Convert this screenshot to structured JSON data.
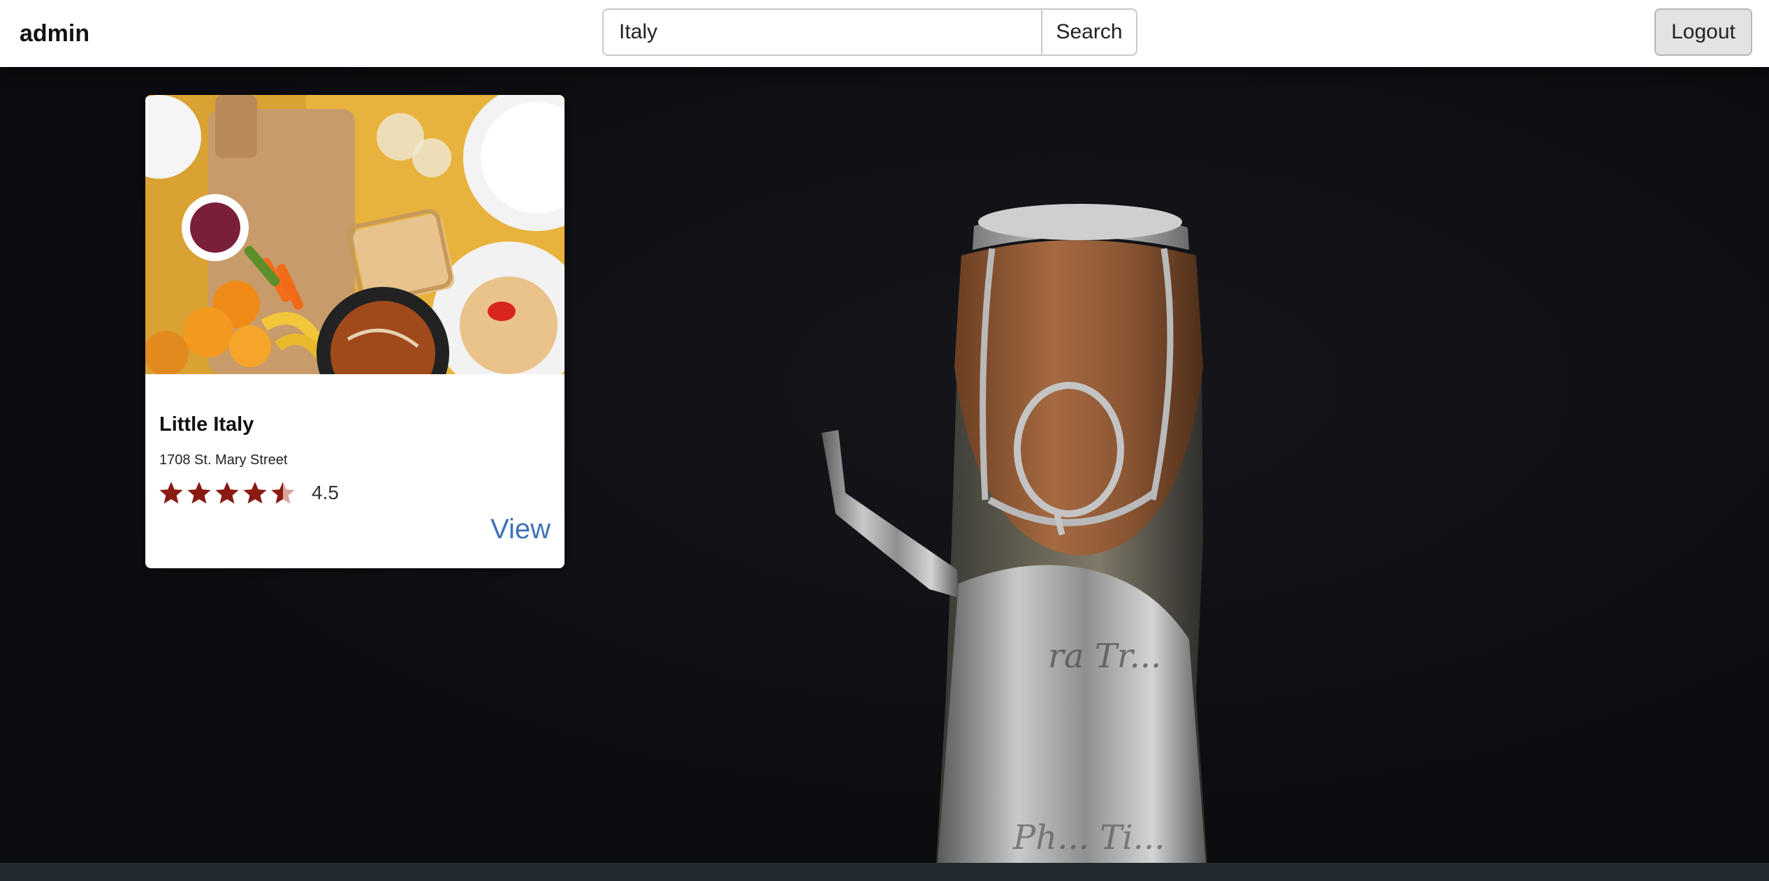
{
  "header": {
    "brand": "admin",
    "search": {
      "value": "Italy",
      "placeholder": "",
      "button_label": "Search"
    },
    "logout_label": "Logout"
  },
  "results": [
    {
      "name": "Little Italy",
      "address": "1708 St. Mary Street",
      "rating": 4.5,
      "rating_label": "4.5",
      "max_rating": 5,
      "view_label": "View",
      "image": "food-spread-photo"
    }
  ],
  "background": {
    "image": "champagne-bottle-cork-photo"
  },
  "colors": {
    "star": "#8a1a12",
    "star_empty": "#d9a39e",
    "link": "#3e72b8",
    "header_bg": "#ffffff",
    "page_bg": "#0d0d10"
  }
}
